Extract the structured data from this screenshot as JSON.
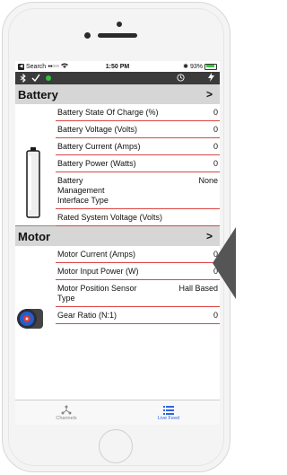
{
  "status_bar": {
    "back_label": "Search",
    "carrier_dots": "●●○○○",
    "wifi": "wifi-icon",
    "time": "1:50 PM",
    "bluetooth": "bluetooth-icon",
    "battery_pct": "93%",
    "battery_color": "#35c83b"
  },
  "toolbar": {
    "icons": [
      "bluetooth-icon",
      "check-icon",
      "connection-dot-icon",
      "clock-icon",
      "lightning-icon"
    ],
    "dot_color": "#31c13a"
  },
  "sections": [
    {
      "title": "Battery",
      "chevron": ">",
      "icon": "battery-icon",
      "rows": [
        {
          "label": "Battery State Of Charge (%)",
          "value": "0"
        },
        {
          "label": "Battery Voltage (Volts)",
          "value": "0"
        },
        {
          "label": "Battery Current (Amps)",
          "value": "0"
        },
        {
          "label": "Battery Power (Watts)",
          "value": "0"
        },
        {
          "label": "Battery Management Interface Type",
          "value": "None"
        },
        {
          "label": "Rated System Voltage (Volts)",
          "value": ""
        }
      ]
    },
    {
      "title": "Motor",
      "chevron": ">",
      "icon": "motor-icon",
      "rows": [
        {
          "label": "Motor Current (Amps)",
          "value": "0"
        },
        {
          "label": "Motor Input Power (W)",
          "value": "0"
        },
        {
          "label": "Motor Position Sensor Type",
          "value": "Hall Based"
        },
        {
          "label": "Gear Ratio (N:1)",
          "value": "0"
        }
      ]
    }
  ],
  "tabs": [
    {
      "label": "Channels",
      "icon": "channels-icon",
      "active": false
    },
    {
      "label": "Live Feed",
      "icon": "list-icon",
      "active": true
    }
  ],
  "colors": {
    "row_divider": "#dd4444",
    "section_header_bg": "#d6d6d6",
    "toolbar_bg": "#3b3b3b",
    "active_tab": "#2f63e3"
  }
}
